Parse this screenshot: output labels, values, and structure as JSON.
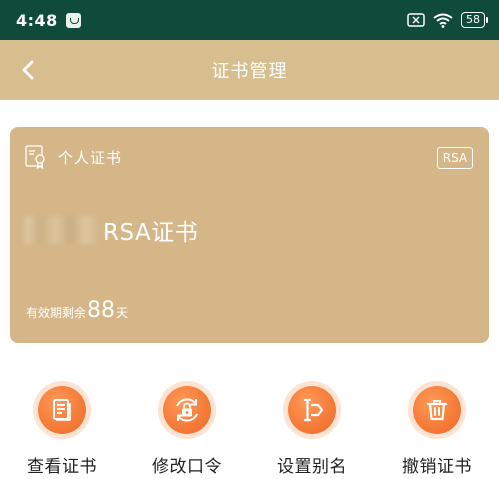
{
  "status_bar": {
    "time": "4:48",
    "battery": "58"
  },
  "nav": {
    "title": "证书管理"
  },
  "card": {
    "type_label": "个人证书",
    "badge": "RSA",
    "name": "RSA证书",
    "validity_prefix": "有效期剩余",
    "validity_days": "88",
    "validity_suffix": "天"
  },
  "actions": [
    {
      "label": "查看证书",
      "icon": "document-icon"
    },
    {
      "label": "修改口令",
      "icon": "lock-refresh-icon"
    },
    {
      "label": "设置别名",
      "icon": "rename-icon"
    },
    {
      "label": "撤销证书",
      "icon": "trash-icon"
    }
  ],
  "colors": {
    "status_bar": "#0f4a3a",
    "nav_bar": "#d7be8f",
    "card": "#d5b688",
    "accent": "#f47a37"
  }
}
